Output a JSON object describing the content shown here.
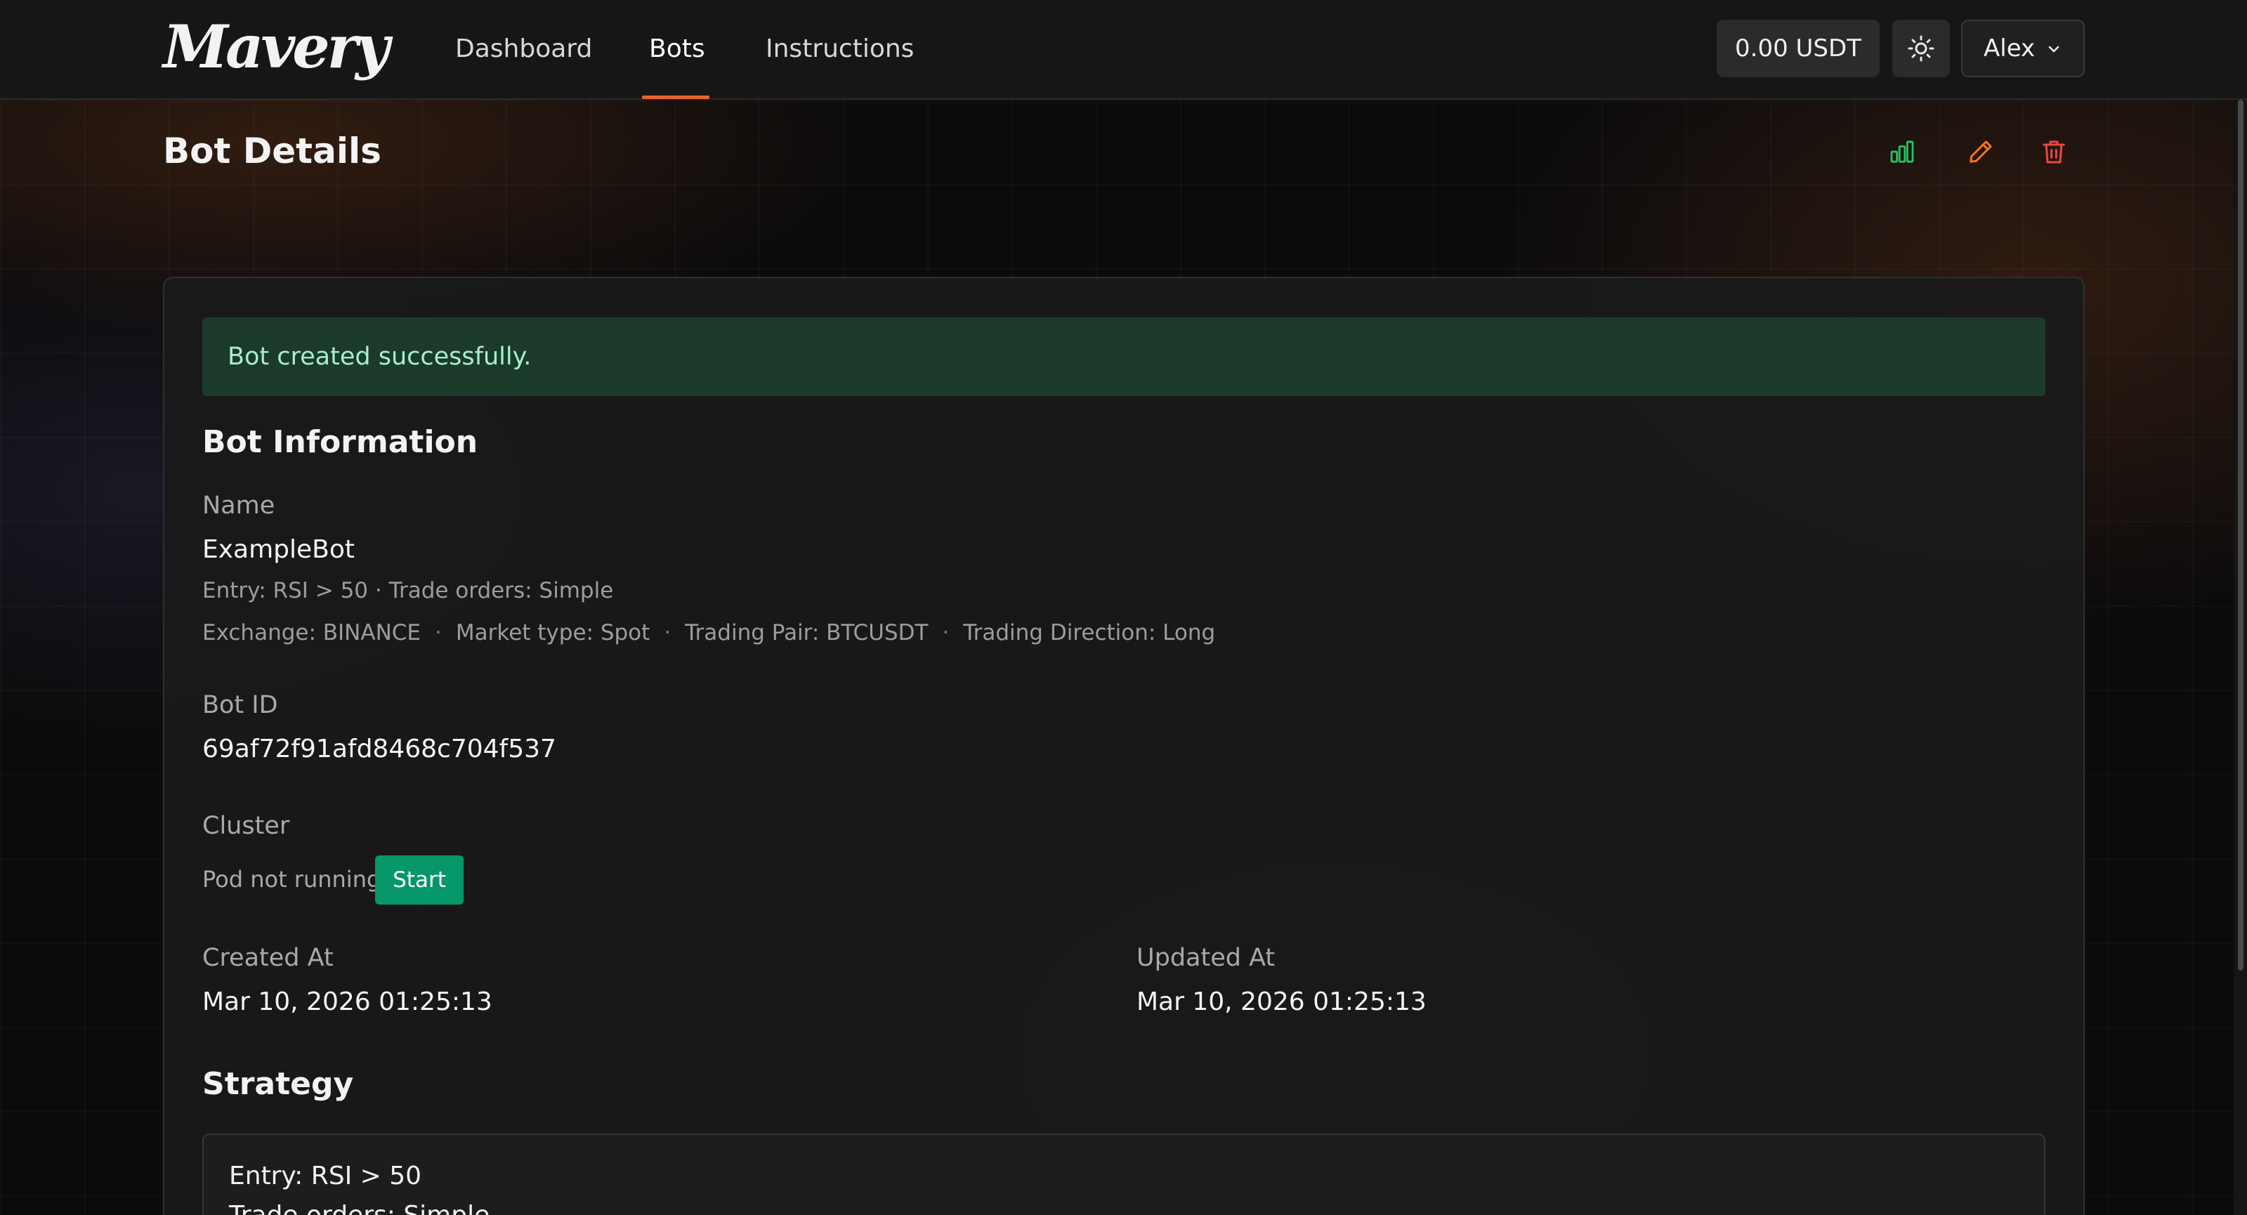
{
  "app": {
    "brand": "Mavery"
  },
  "nav": {
    "items": [
      {
        "label": "Dashboard",
        "active": false
      },
      {
        "label": "Bots",
        "active": true
      },
      {
        "label": "Instructions",
        "active": false
      }
    ],
    "accent_color": "#e8632c"
  },
  "header": {
    "balance": "0.00 USDT",
    "theme_icon": "sun-icon",
    "user": "Alex",
    "user_icon": "chevron-down-icon"
  },
  "page": {
    "title": "Bot Details",
    "actions": [
      {
        "name": "statistics",
        "icon": "bar-chart-icon",
        "color": "#22c55e"
      },
      {
        "name": "edit",
        "icon": "pencil-icon",
        "color": "#f97316"
      },
      {
        "name": "delete",
        "icon": "trash-icon",
        "color": "#ef4444"
      }
    ]
  },
  "alert": {
    "message": "Bot created successfully.",
    "color": "#a7f0c4"
  },
  "bot_info": {
    "section_title": "Bot Information",
    "name_label": "Name",
    "name": "ExampleBot",
    "summary": "Entry: RSI > 50 · Trade orders: Simple",
    "meta": [
      "Exchange: BINANCE",
      "Market type: Spot",
      "Trading Pair: BTCUSDT",
      "Trading Direction: Long"
    ],
    "meta_separator": "·",
    "bot_id_label": "Bot ID",
    "bot_id": "69af72f91afd8468c704f537",
    "cluster_label": "Cluster",
    "pod_status": "Pod not running",
    "start_label": "Start",
    "start_color": "#059669",
    "created_label": "Created At",
    "created_at": "Mar 10, 2026 01:25:13",
    "updated_label": "Updated At",
    "updated_at": "Mar 10, 2026 01:25:13"
  },
  "strategy": {
    "section_title": "Strategy",
    "lines": [
      "Entry: RSI > 50",
      "Trade orders: Simple"
    ]
  }
}
